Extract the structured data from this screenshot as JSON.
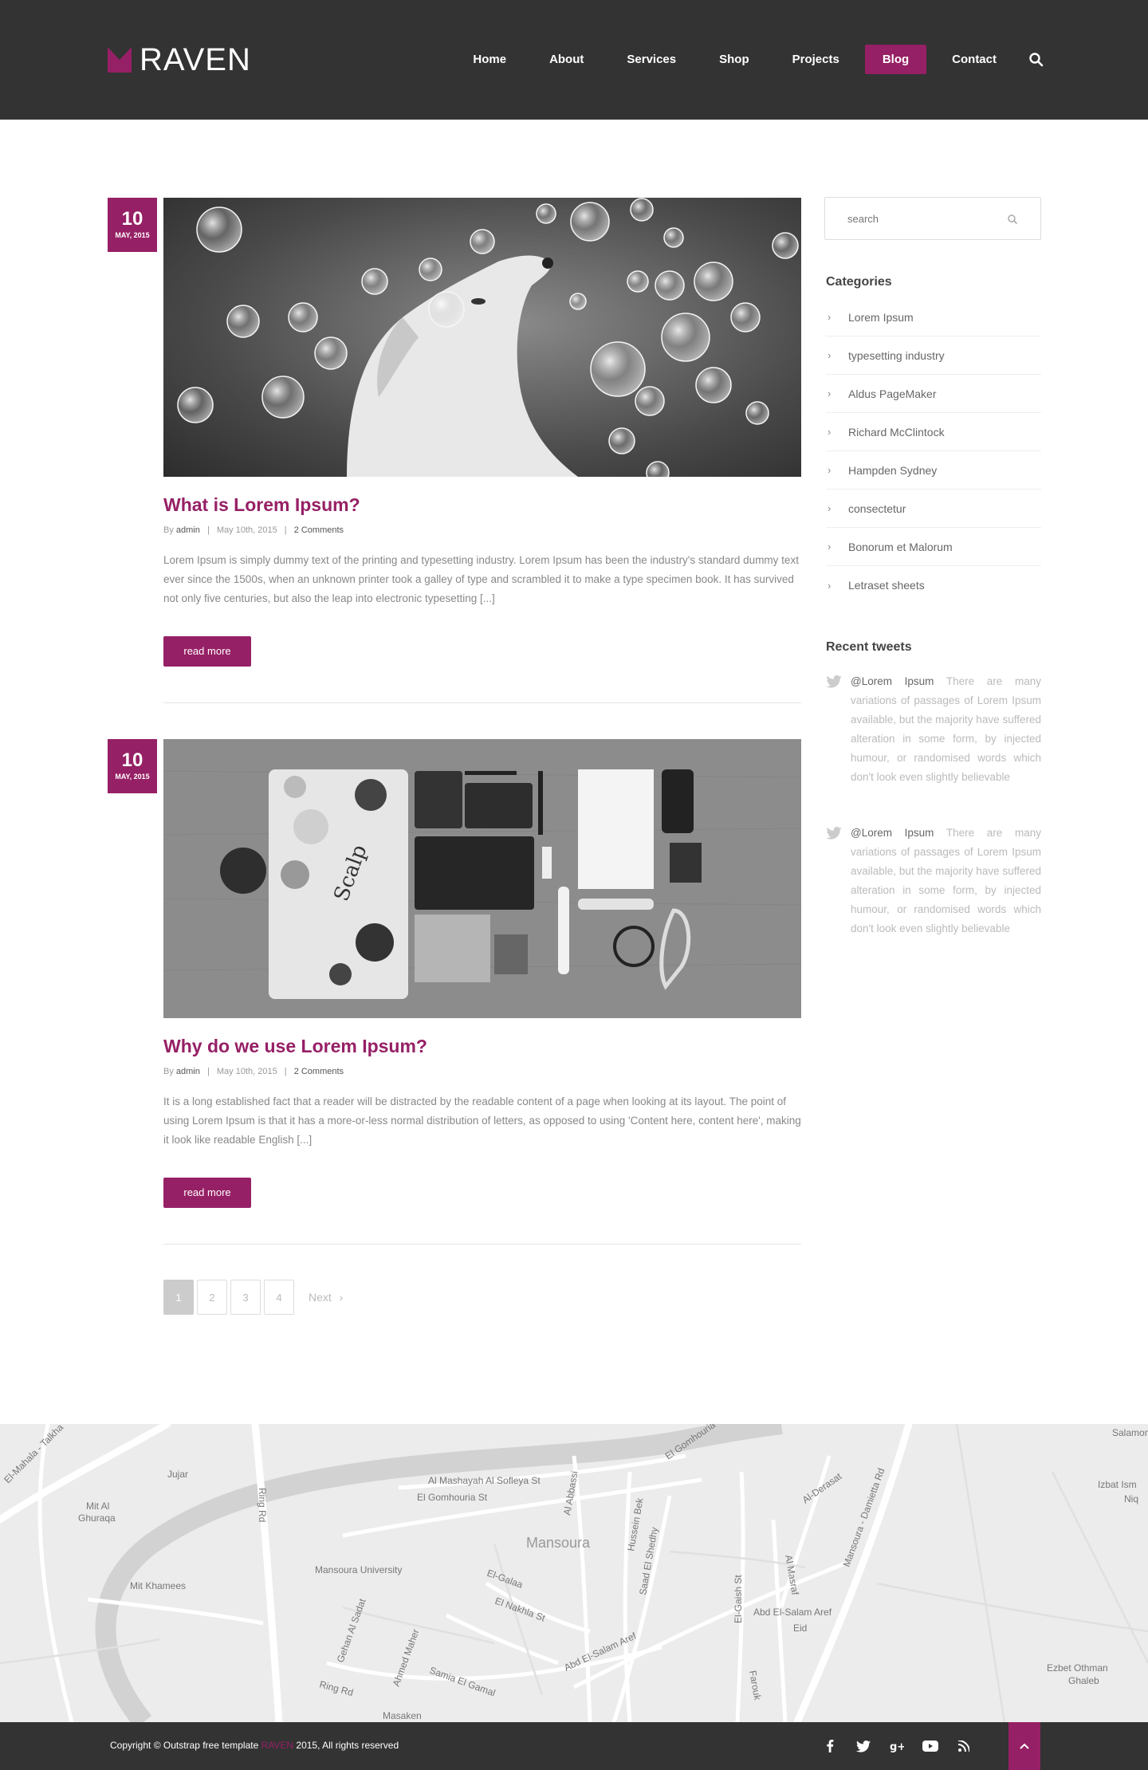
{
  "brand": {
    "logo_text": "RAVEN",
    "accent": "#962065",
    "dark": "#333333"
  },
  "nav": {
    "items": [
      {
        "label": "Home"
      },
      {
        "label": "About"
      },
      {
        "label": "Services"
      },
      {
        "label": "Shop"
      },
      {
        "label": "Projects"
      },
      {
        "label": "Blog",
        "active": true
      },
      {
        "label": "Contact"
      }
    ],
    "search_icon": "search-icon"
  },
  "posts": [
    {
      "day": "10",
      "month": "MAY, 2015",
      "image": "dog-with-bubbles-photo",
      "title": "What is Lorem Ipsum?",
      "meta": {
        "by": "By",
        "author": "admin",
        "date": "May 10th, 2015",
        "comments": "2 Comments"
      },
      "excerpt": "Lorem Ipsum is simply dummy text of the printing and typesetting industry. Lorem Ipsum has been the industry's standard dummy text ever since the 1500s, when an unknown printer took a galley of type and scrambled it to make a type specimen book. It has survived not only five centuries, but also the leap into electronic typesetting [...]",
      "read_more": "read more"
    },
    {
      "day": "10",
      "month": "MAY, 2015",
      "image": "desk-flatlay-photo",
      "title": "Why do we use Lorem Ipsum?",
      "meta": {
        "by": "By",
        "author": "admin",
        "date": "May 10th, 2015",
        "comments": "2 Comments"
      },
      "excerpt": "It is a long established fact that a reader will be distracted by the readable content of a page when looking at its layout. The point of using Lorem Ipsum is that it has a more-or-less normal distribution of letters, as opposed to using 'Content here, content here', making it look like readable English [...]",
      "read_more": "read more"
    }
  ],
  "pagination": {
    "pages": [
      "1",
      "2",
      "3",
      "4"
    ],
    "current": "1",
    "next": "Next"
  },
  "sidebar": {
    "search_placeholder": "search",
    "categories_heading": "Categories",
    "categories": [
      "Lorem Ipsum",
      "typesetting industry",
      "Aldus PageMaker",
      "Richard McClintock",
      "Hampden Sydney",
      "consectetur",
      "Bonorum et Malorum",
      "Letraset sheets"
    ],
    "tweets_heading": "Recent tweets",
    "tweets": [
      {
        "handle": "@Lorem Ipsum",
        "text": "There are many variations of passages of Lorem Ipsum available, but the majority have suffered alteration in some form, by injected humour, or randomised words which don't look even slightly believable"
      },
      {
        "handle": "@Lorem Ipsum",
        "text": "There are many variations of passages of Lorem Ipsum available, but the majority have suffered alteration in some form, by injected humour, or randomised words which don't look even slightly believable"
      }
    ]
  },
  "map": {
    "labels": [
      "El-Mahala - Talkha",
      "Jujar",
      "Mit Al Ghuraqa",
      "Mit Khamees",
      "Ring Rd",
      "Mansoura University",
      "Al Mashayah Al Sofleya St",
      "El Gomhouria St",
      "Mansoura",
      "Al Abbassi",
      "Hussein Bek",
      "Saad El Shedhy",
      "El-Galaa",
      "El Nakhla St",
      "Gehan Al Sadat",
      "Ahmed Maher",
      "Samia El Gamal",
      "Abd El-Salam Aref",
      "El-Gaish St",
      "Al Masraf",
      "Al-Derasat",
      "Mansoura - Damietta Rd",
      "Izbat Ism Niq",
      "Ezbet Othman Ghaleb",
      "Farouk",
      "Eid",
      "Masaken",
      "El Gomhouria St",
      "Salamon"
    ]
  },
  "footer": {
    "copyright_prefix": "Copyright © Outstrap free template",
    "copyright_brand": "RAVEN",
    "copyright_suffix": "2015, All rights reserved",
    "social": [
      "facebook-icon",
      "twitter-icon",
      "google-plus-icon",
      "youtube-icon",
      "rss-icon"
    ]
  }
}
